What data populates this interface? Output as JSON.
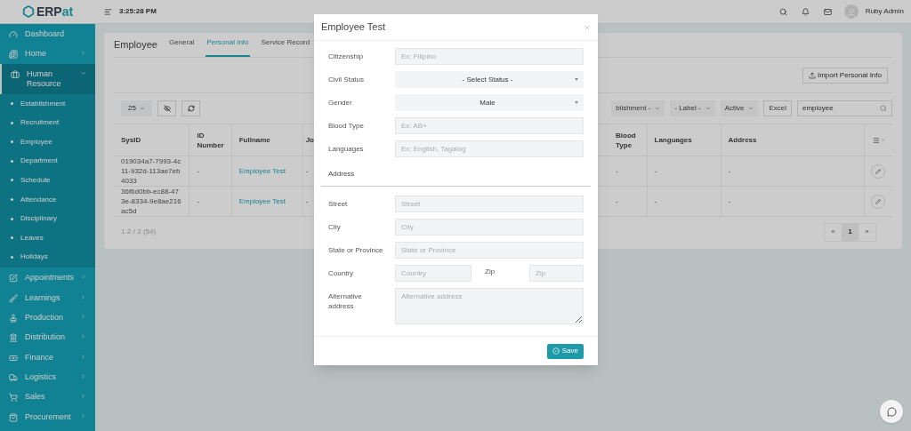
{
  "logo": {
    "main": "ERP",
    "accent": "at"
  },
  "topbar": {
    "time": "3:25:28 PM",
    "user": "Ruby Admin"
  },
  "sidebar": {
    "items": [
      {
        "kind": "link",
        "label": "Dashboard",
        "selected": false
      },
      {
        "kind": "menu",
        "label": "Home",
        "selected": false,
        "expanded": false
      },
      {
        "kind": "menu",
        "label": "Human Resource",
        "selected": true,
        "expanded": true,
        "children": [
          {
            "label": "Establishment"
          },
          {
            "label": "Recruitment"
          },
          {
            "label": "Employee"
          },
          {
            "label": "Department"
          },
          {
            "label": "Schedule"
          },
          {
            "label": "Attendance"
          },
          {
            "label": "Disciplinary"
          },
          {
            "label": "Leaves"
          },
          {
            "label": "Holidays"
          }
        ]
      },
      {
        "kind": "menu",
        "label": "Appointments",
        "selected": false,
        "expanded": false
      },
      {
        "kind": "menu",
        "label": "Learnings",
        "selected": false,
        "expanded": false
      },
      {
        "kind": "menu",
        "label": "Production",
        "selected": false,
        "expanded": false
      },
      {
        "kind": "menu",
        "label": "Distribution",
        "selected": false,
        "expanded": false
      },
      {
        "kind": "menu",
        "label": "Finance",
        "selected": false,
        "expanded": false
      },
      {
        "kind": "menu",
        "label": "Logistics",
        "selected": false,
        "expanded": false
      },
      {
        "kind": "menu",
        "label": "Sales",
        "selected": false,
        "expanded": false
      },
      {
        "kind": "menu",
        "label": "Procurement",
        "selected": false,
        "expanded": false
      }
    ]
  },
  "page": {
    "title": "Employee",
    "tabs": [
      {
        "label": "General",
        "selected": false
      },
      {
        "label": "Personal Info",
        "selected": true
      },
      {
        "label": "Service Record",
        "selected": false
      }
    ],
    "import_button": "Import Personal Info",
    "page_size": "25",
    "filters": [
      {
        "label": "blishment -"
      },
      {
        "label": "- Label -"
      },
      {
        "label": "Active"
      }
    ],
    "excel_button": "Excel",
    "search": {
      "value": "employee"
    },
    "table": {
      "columns": [
        "SysID",
        "ID Number",
        "Fullname",
        "Jo",
        "Blood Type",
        "Languages",
        "Address"
      ],
      "rows": [
        {
          "cells": [
            "019034a7-7993-4c11-932d-113ae7eb4033",
            "-",
            "Employee Test",
            "-",
            "-",
            "-",
            "-"
          ]
        },
        {
          "cells": [
            "36f6d0bb-ec88-473e-8334-9e8ae216ac5d",
            "-",
            "Employee Test",
            "-",
            "-",
            "-",
            "-"
          ]
        }
      ]
    },
    "summary": "1-2 / 2 (54)",
    "pagination": [
      {
        "label": "«",
        "selected": false
      },
      {
        "label": "1",
        "selected": true
      },
      {
        "label": "»",
        "selected": false
      }
    ]
  },
  "modal": {
    "title": "Employee Test",
    "fields": [
      {
        "kind": "input",
        "label": "Citizenship",
        "placeholder": "Ex: Filipino"
      },
      {
        "kind": "select",
        "label": "Civil Status",
        "value": "- Select Status -"
      },
      {
        "kind": "select",
        "label": "Gender",
        "value": "Male"
      },
      {
        "kind": "input",
        "label": "Blood Type",
        "placeholder": "Ex: AB+"
      },
      {
        "kind": "input",
        "label": "Languages",
        "placeholder": "Ex: English, Tagalog"
      }
    ],
    "section": "Address",
    "address_fields": [
      {
        "kind": "input",
        "label": "Street",
        "placeholder": "Street"
      },
      {
        "kind": "input",
        "label": "City",
        "placeholder": "City"
      },
      {
        "kind": "input",
        "label": "State or Province",
        "placeholder": "State or Province"
      },
      {
        "kind": "pair",
        "label": "Country",
        "placeholder": "Country",
        "label2": "Zip",
        "placeholder2": "Zip"
      },
      {
        "kind": "textarea",
        "label": "Alternative address",
        "placeholder": "Alternative address"
      }
    ],
    "save_button": "Save"
  }
}
